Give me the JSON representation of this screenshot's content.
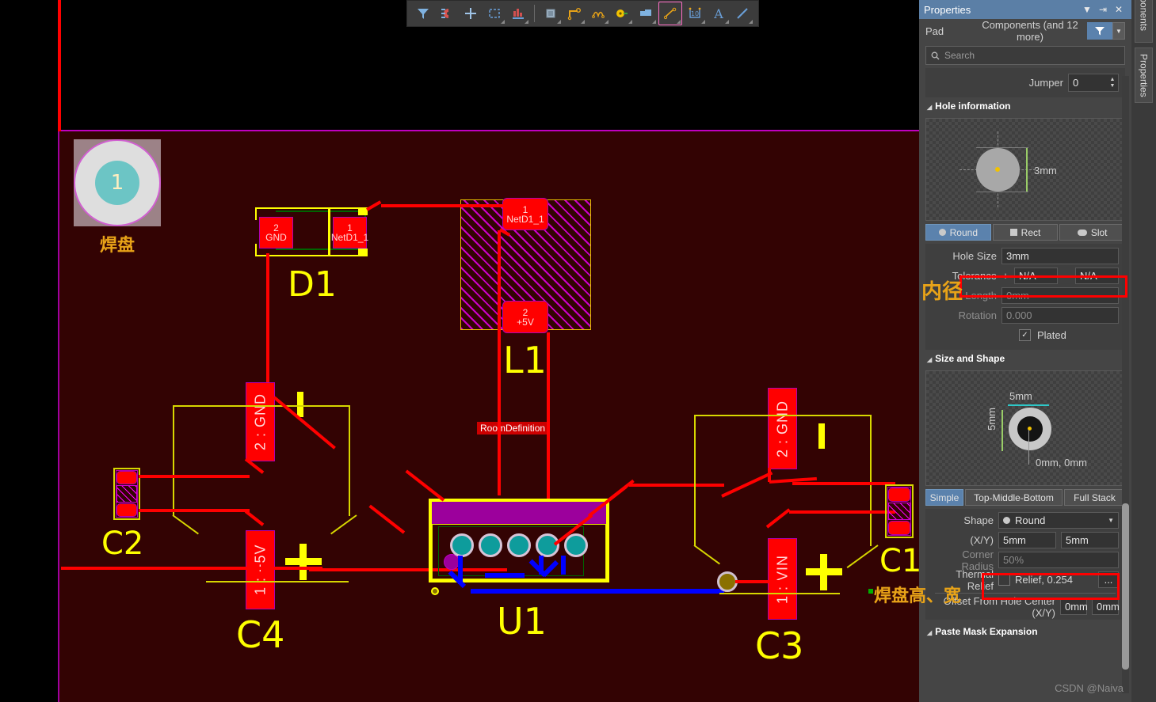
{
  "panel": {
    "title": "Properties",
    "title_icons": [
      "chevron-down",
      "pin",
      "close"
    ],
    "object_label": "Pad",
    "object_value": "Components (and 12 more)",
    "search_placeholder": "Search",
    "jumper": {
      "label": "Jumper",
      "value": "0"
    },
    "hole_information": {
      "section_title": "Hole information",
      "preview_dimension": "3mm",
      "shape_tabs": [
        {
          "label": "Round",
          "selected": true,
          "icon": "round-hole-icon"
        },
        {
          "label": "Rect",
          "selected": false,
          "icon": "rect-hole-icon"
        },
        {
          "label": "Slot",
          "selected": false,
          "icon": "slot-hole-icon"
        }
      ],
      "hole_size": {
        "label": "Hole Size",
        "value": "3mm"
      },
      "tolerance": {
        "label": "Tolerance",
        "plus": "+",
        "plus_value": "N/A",
        "minus": "-",
        "minus_value": "N/A"
      },
      "length": {
        "label": "Length",
        "value": "0mm"
      },
      "rotation": {
        "label": "Rotation",
        "value": "0.000"
      },
      "plated": {
        "label": "Plated",
        "checked": true
      }
    },
    "size_and_shape": {
      "section_title": "Size and Shape",
      "preview_width": "5mm",
      "preview_height": "5mm",
      "preview_offset": "0mm, 0mm",
      "stack_tabs": [
        {
          "label": "Simple",
          "selected": true
        },
        {
          "label": "Top-Middle-Bottom",
          "selected": false
        },
        {
          "label": "Full Stack",
          "selected": false
        }
      ],
      "shape": {
        "label": "Shape",
        "value": "Round"
      },
      "xy": {
        "label": "(X/Y)",
        "x": "5mm",
        "y": "5mm"
      },
      "corner_radius": {
        "label": "Corner Radius",
        "value": "50%"
      },
      "thermal_relief": {
        "label": "Thermal Relief",
        "value": "Relief, 0.254",
        "ellipsis": "...",
        "checked": false
      },
      "offset_from_hole_center": {
        "label": "Offset From Hole Center (X/Y)",
        "x": "0mm",
        "y": "0mm"
      }
    },
    "paste_mask_expansion": {
      "section_title": "Paste Mask Expansion"
    }
  },
  "edge_tabs": [
    {
      "label": "Components",
      "highlighted": false
    },
    {
      "label": "Properties",
      "highlighted": true
    }
  ],
  "toolbar": {
    "buttons": [
      {
        "name": "filter-icon",
        "dropdown": false
      },
      {
        "name": "magnet-snap-icon",
        "dropdown": false
      },
      {
        "name": "crosshair-icon",
        "dropdown": false
      },
      {
        "name": "select-area-icon",
        "dropdown": true
      },
      {
        "name": "layer-stack-icon",
        "dropdown": true
      },
      {
        "name": "place-component-icon",
        "dropdown": true
      },
      {
        "name": "place-track-icon",
        "dropdown": true
      },
      {
        "name": "place-arc-icon",
        "dropdown": true
      },
      {
        "name": "place-pad-icon",
        "dropdown": true
      },
      {
        "name": "place-polygon-icon",
        "dropdown": true
      },
      {
        "name": "place-dimension-icon",
        "dropdown": true
      },
      {
        "name": "place-string-icon",
        "dropdown": true
      },
      {
        "name": "place-line-icon",
        "dropdown": true
      }
    ]
  },
  "canvas": {
    "annotations": [
      {
        "id": "pad-note",
        "text": "焊盘"
      },
      {
        "id": "inner-diameter-note",
        "text": "内径"
      },
      {
        "id": "pad-size-note",
        "text": "焊盘高、宽"
      }
    ],
    "designators": [
      "D1",
      "L1",
      "C2",
      "C4",
      "U1",
      "C3",
      "C1"
    ],
    "pads": [
      {
        "component": "D1",
        "number": "2",
        "net": "GND"
      },
      {
        "component": "D1",
        "number": "1",
        "net": "NetD1_1"
      },
      {
        "component": "L1",
        "number": "1",
        "net": "NetD1_1"
      },
      {
        "component": "L1",
        "number": "2",
        "net": "+5V"
      },
      {
        "component": "C4",
        "number": "1",
        "net": "+5V",
        "display": "1 : +5V"
      },
      {
        "component": "C4",
        "number": "2",
        "net": "GND",
        "display": "2 : GND"
      },
      {
        "component": "C3",
        "number": "1",
        "net": "VIN",
        "display": "1 : VIN"
      },
      {
        "component": "C3",
        "number": "2",
        "net": "GND",
        "display": "2 : GND"
      }
    ],
    "room": {
      "label": "RoomDefinition"
    },
    "big_pad": {
      "number": "1"
    }
  },
  "watermark": "CSDN @Naiva"
}
